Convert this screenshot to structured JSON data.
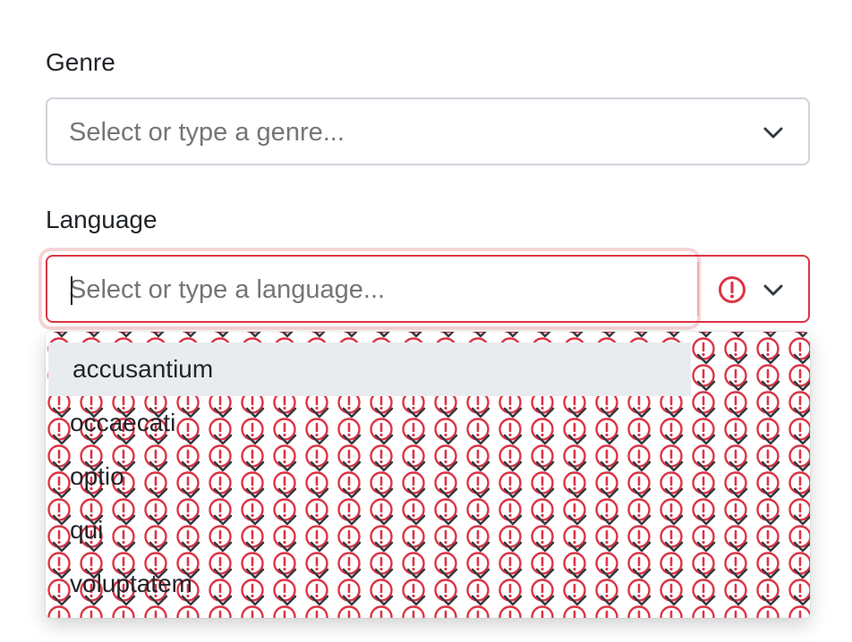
{
  "form": {
    "genre": {
      "label": "Genre",
      "placeholder": "Select or type a genre..."
    },
    "language": {
      "label": "Language",
      "placeholder": "Select or type a language...",
      "invalid": true,
      "options": [
        "accusantium",
        "occaecati",
        "optio",
        "qui",
        "voluptatem"
      ],
      "highlighted_index": 0
    }
  },
  "icons": {
    "dropdown": "chevron-down-icon",
    "error": "error-circle-icon"
  },
  "colors": {
    "error": "#dc3545",
    "border": "#ced4da",
    "highlight": "#e9ecef",
    "text": "#212529",
    "placeholder": "#6c757d"
  }
}
